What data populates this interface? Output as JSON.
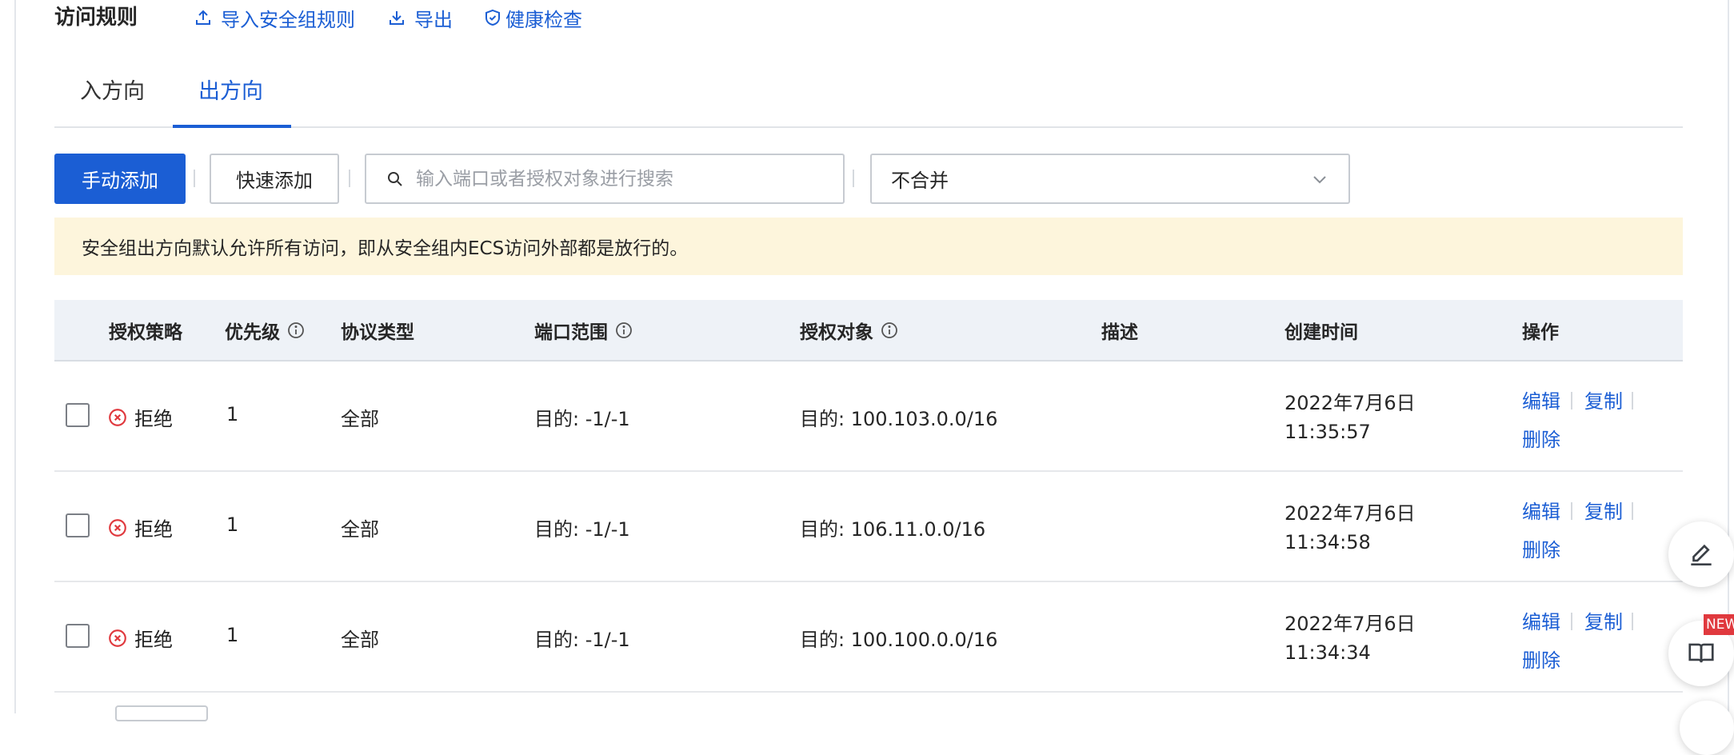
{
  "header": {
    "title": "访问规则",
    "import_label": "导入安全组规则",
    "export_label": "导出",
    "health_label": "健康检查"
  },
  "tabs": [
    {
      "label": "入方向",
      "active": false
    },
    {
      "label": "出方向",
      "active": true
    }
  ],
  "toolbar": {
    "manual_add_label": "手动添加",
    "quick_add_label": "快速添加",
    "search_placeholder": "输入端口或者授权对象进行搜索",
    "merge_select_value": "不合并"
  },
  "notice": "安全组出方向默认允许所有访问，即从安全组内ECS访问外部都是放行的。",
  "table": {
    "columns": [
      "授权策略",
      "优先级",
      "协议类型",
      "端口范围",
      "授权对象",
      "描述",
      "创建时间",
      "操作"
    ],
    "rows": [
      {
        "policy": "拒绝",
        "priority": "1",
        "protocol": "全部",
        "port": "目的: -1/-1",
        "target": "目的: 100.103.0.0/16",
        "desc": "",
        "date": "2022年7月6日",
        "time": "11:35:57"
      },
      {
        "policy": "拒绝",
        "priority": "1",
        "protocol": "全部",
        "port": "目的: -1/-1",
        "target": "目的: 106.11.0.0/16",
        "desc": "",
        "date": "2022年7月6日",
        "time": "11:34:58"
      },
      {
        "policy": "拒绝",
        "priority": "1",
        "protocol": "全部",
        "port": "目的: -1/-1",
        "target": "目的: 100.100.0.0/16",
        "desc": "",
        "date": "2022年7月6日",
        "time": "11:34:34"
      }
    ],
    "actions": {
      "edit": "编辑",
      "copy": "复制",
      "delete": "删除"
    }
  },
  "floating": {
    "new_badge": "NEW"
  },
  "colors": {
    "accent": "#1b5ed4",
    "deny": "#e0393e",
    "notice_bg": "#fdf5dc",
    "header_bg": "#eef2f7"
  }
}
